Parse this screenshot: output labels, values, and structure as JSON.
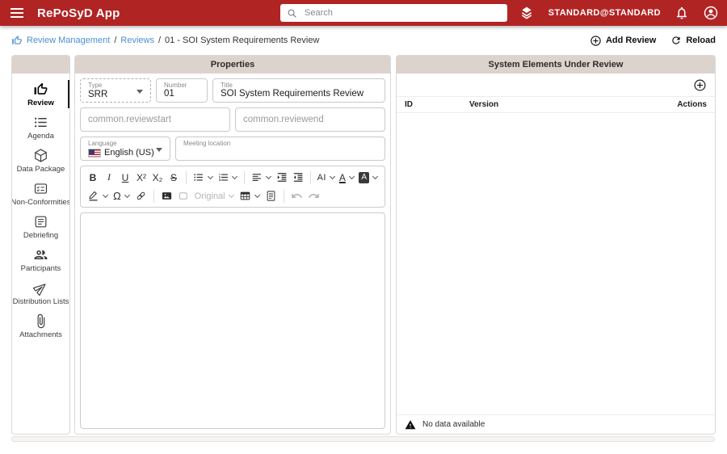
{
  "header": {
    "app_title": "RePoSyD App",
    "search_placeholder": "Search",
    "account_label": "STANDARD@STANDARD"
  },
  "breadcrumb": {
    "separator": "/",
    "items": [
      {
        "label": "Review Management"
      },
      {
        "label": "Reviews"
      },
      {
        "label": "01 - SOI System Requirements Review"
      }
    ]
  },
  "toolbar": {
    "add_review_label": "Add Review",
    "reload_label": "Reload"
  },
  "sidebar": {
    "items": [
      {
        "label": "Review",
        "icon": "thumb-up",
        "active": true
      },
      {
        "label": "Agenda",
        "icon": "bulleted-list"
      },
      {
        "label": "Data Package",
        "icon": "cube"
      },
      {
        "label": "Non-Conformities",
        "icon": "checklist"
      },
      {
        "label": "Debriefing",
        "icon": "article"
      },
      {
        "label": "Participants",
        "icon": "group"
      },
      {
        "label": "Distribution Lists",
        "icon": "paper-plane"
      },
      {
        "label": "Attachments",
        "icon": "paperclip"
      }
    ]
  },
  "properties": {
    "title": "Properties",
    "fields": {
      "type": {
        "label": "Type",
        "value": "SRR"
      },
      "number": {
        "label": "Number",
        "value": "01"
      },
      "doc_title": {
        "label": "Title",
        "value": "SOI System Requirements Review"
      },
      "review_start": {
        "placeholder": "common.reviewstart"
      },
      "review_end": {
        "placeholder": "common.reviewend"
      },
      "language": {
        "label": "Language",
        "value": "English (US)"
      },
      "meeting_location": {
        "label": "Meeting location"
      }
    }
  },
  "editor_toolbar": {
    "bold": "B",
    "italic": "I",
    "underline": "U",
    "superscript": "X²",
    "subscript": "X₂",
    "strikethrough": "S",
    "font_size": "AI",
    "font_color": "A",
    "bg_color": "A",
    "special_char": "Ω",
    "resize_original": "Original"
  },
  "elements_panel": {
    "title": "System Elements Under Review",
    "columns": {
      "id": "ID",
      "version": "Version",
      "actions": "Actions"
    },
    "empty_message": "No data available"
  },
  "icons": {
    "menu": "hamburger",
    "search": "magnifier",
    "add": "plus-circle",
    "workspace": "layers",
    "notifications": "bell",
    "account": "person-circle",
    "reload": "circular-arrow",
    "empty_state": "warning-triangle"
  },
  "colors": {
    "header_red": "#b12424",
    "panel_header_beige": "#ddd3cd",
    "link_blue": "#4d8fd1",
    "active_indicator": "#1a1a1a"
  }
}
